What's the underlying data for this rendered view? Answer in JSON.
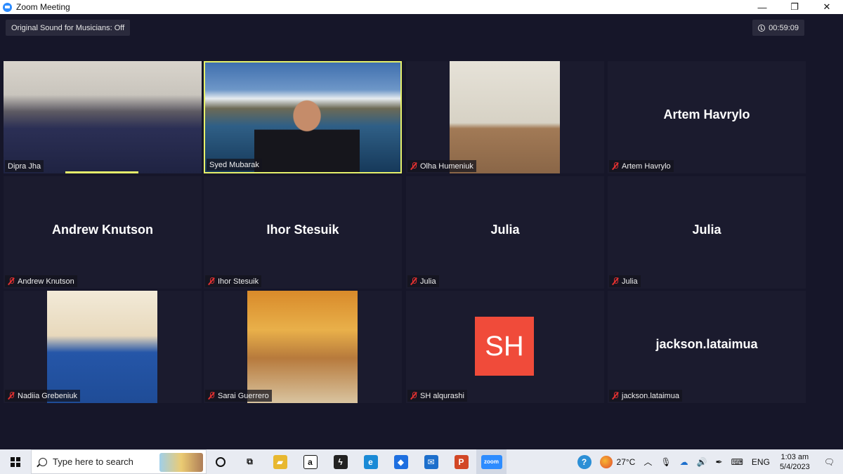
{
  "window": {
    "title": "Zoom Meeting",
    "minimize": "—",
    "maximize": "❐",
    "close": "✕"
  },
  "meeting": {
    "original_sound": "Original Sound for Musicians: Off",
    "timer": "00:59:09"
  },
  "tiles": [
    {
      "name": "Dipra Jha",
      "show_big": "",
      "muted": false,
      "kind": "video-classroom"
    },
    {
      "name": "Syed Mubarak",
      "show_big": "",
      "muted": false,
      "kind": "video-lake",
      "active": true
    },
    {
      "name": "Olha Humeniuk",
      "show_big": "",
      "muted": true,
      "kind": "video-olha"
    },
    {
      "name": "Artem Havrylo",
      "show_big": "Artem Havrylo",
      "muted": true,
      "kind": "name"
    },
    {
      "name": "Andrew Knutson",
      "show_big": "Andrew Knutson",
      "muted": true,
      "kind": "name"
    },
    {
      "name": "Ihor Stesuik",
      "show_big": "Ihor Stesuik",
      "muted": true,
      "kind": "name"
    },
    {
      "name": "Julia",
      "show_big": "Julia",
      "muted": true,
      "kind": "name"
    },
    {
      "name": "Julia",
      "show_big": "Julia",
      "muted": true,
      "kind": "name"
    },
    {
      "name": "Nadiia Grebeniuk",
      "show_big": "",
      "muted": true,
      "kind": "video-nadiia"
    },
    {
      "name": "Sarai Guerrero",
      "show_big": "",
      "muted": true,
      "kind": "video-sarai"
    },
    {
      "name": "SH alqurashi",
      "show_big": "",
      "muted": true,
      "kind": "initials",
      "initials": "SH"
    },
    {
      "name": "jackson.lataimua",
      "show_big": "jackson.lataimua",
      "muted": true,
      "kind": "name"
    }
  ],
  "taskbar": {
    "search_placeholder": "Type here to search",
    "apps": [
      {
        "icon": "task-view-icon",
        "glyph": "⧉"
      },
      {
        "icon": "file-explorer-icon",
        "glyph": "▰",
        "color": "#e8b830"
      },
      {
        "icon": "amazon-icon",
        "glyph": "a",
        "color": "#111111"
      },
      {
        "icon": "swift-icon",
        "glyph": "ϟ",
        "color": "#222222"
      },
      {
        "icon": "edge-icon",
        "glyph": "e",
        "color": "#1a8ad6"
      },
      {
        "icon": "dropbox-icon",
        "glyph": "◆",
        "color": "#1e6fe0"
      },
      {
        "icon": "mail-icon",
        "glyph": "✉",
        "color": "#1d6fcc"
      },
      {
        "icon": "powerpoint-icon",
        "glyph": "P",
        "color": "#d24726"
      },
      {
        "icon": "zoom-icon",
        "glyph": "zoom",
        "color": "#2d8cff"
      }
    ],
    "weather": "27°C",
    "language": "ENG",
    "time": "1:03 am",
    "date": "5/4/2023"
  }
}
